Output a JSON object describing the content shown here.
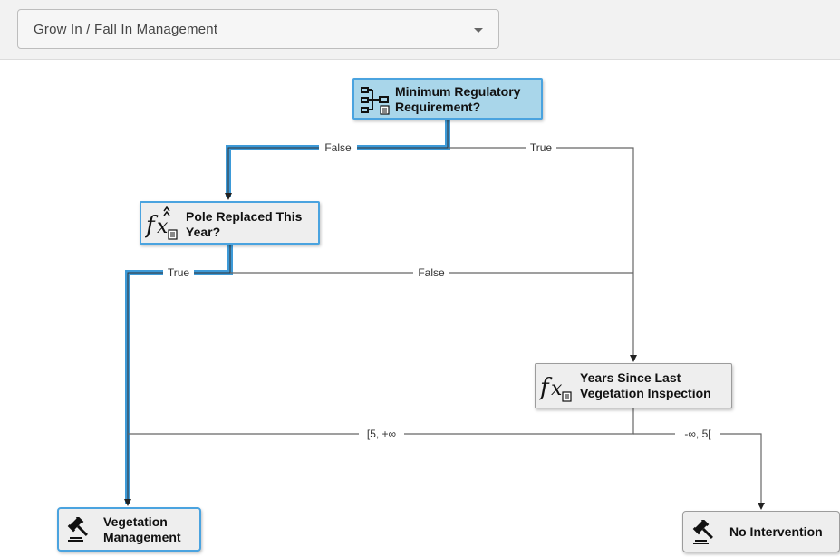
{
  "header": {
    "dropdown": {
      "value": "Grow In / Fall In Management"
    }
  },
  "nodes": {
    "root": {
      "label": "Minimum Regulatory\nRequirement?",
      "icon": "decision-tree-icon"
    },
    "pole": {
      "label": "Pole Replaced This\nYear?",
      "icon": "function-icon"
    },
    "years": {
      "label": "Years Since Last\nVegetation Inspection",
      "icon": "function-icon"
    },
    "veg": {
      "label": "Vegetation\nManagement",
      "icon": "gavel-icon"
    },
    "none": {
      "label": "No Intervention",
      "icon": "gavel-icon"
    }
  },
  "edges": {
    "root_false": "False",
    "root_true": "True",
    "pole_true": "True",
    "pole_false": "False",
    "years_ge5": "[5, +∞",
    "years_lt5": "-∞, 5["
  },
  "colors": {
    "highlight": "#3d9ad8",
    "line": "#666666",
    "root_fill": "#a9d6ea"
  }
}
